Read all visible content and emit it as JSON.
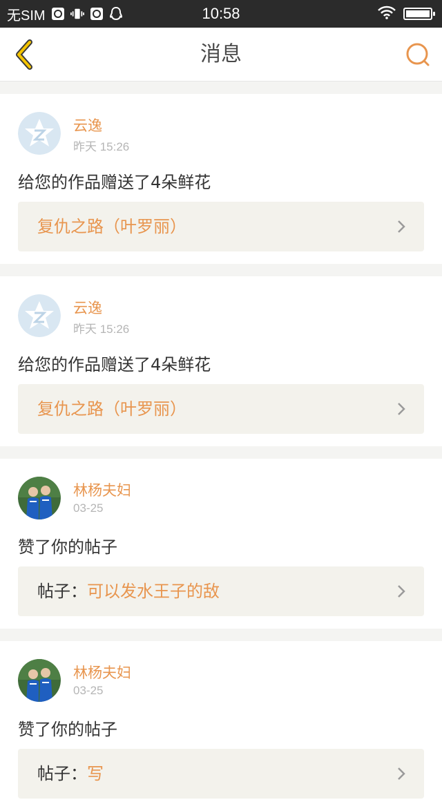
{
  "status_bar": {
    "carrier": "无SIM",
    "time": "10:58",
    "battery_level": 0.95,
    "icons": [
      "qq-browser-icon",
      "vibrate-icon",
      "qq-browser-icon",
      "qq-icon",
      "wifi-icon",
      "battery-icon"
    ]
  },
  "header": {
    "title": "消息",
    "back_icon": "chevron-left-icon",
    "search_icon": "search-icon"
  },
  "colors": {
    "accent": "#e8954e",
    "back_arrow": "#f5c400",
    "ref_bg": "#f3f2ec",
    "page_bg": "#f4f4f2"
  },
  "messages": [
    {
      "avatar": "default-qzone-avatar",
      "username": "云逸",
      "time": "昨天 15:26",
      "text": "给您的作品赠送了4朵鲜花",
      "ref_prefix": "",
      "ref_title": "复仇之路（叶罗丽）"
    },
    {
      "avatar": "default-qzone-avatar",
      "username": "云逸",
      "time": "昨天 15:26",
      "text": "给您的作品赠送了4朵鲜花",
      "ref_prefix": "",
      "ref_title": "复仇之路（叶罗丽）"
    },
    {
      "avatar": "photo-avatar",
      "username": "林杨夫妇",
      "time": "03-25",
      "text": "赞了你的帖子",
      "ref_prefix": "帖子：",
      "ref_title": "可以发水王子的敌"
    },
    {
      "avatar": "photo-avatar",
      "username": "林杨夫妇",
      "time": "03-25",
      "text": "赞了你的帖子",
      "ref_prefix": "帖子：",
      "ref_title": "写"
    }
  ]
}
